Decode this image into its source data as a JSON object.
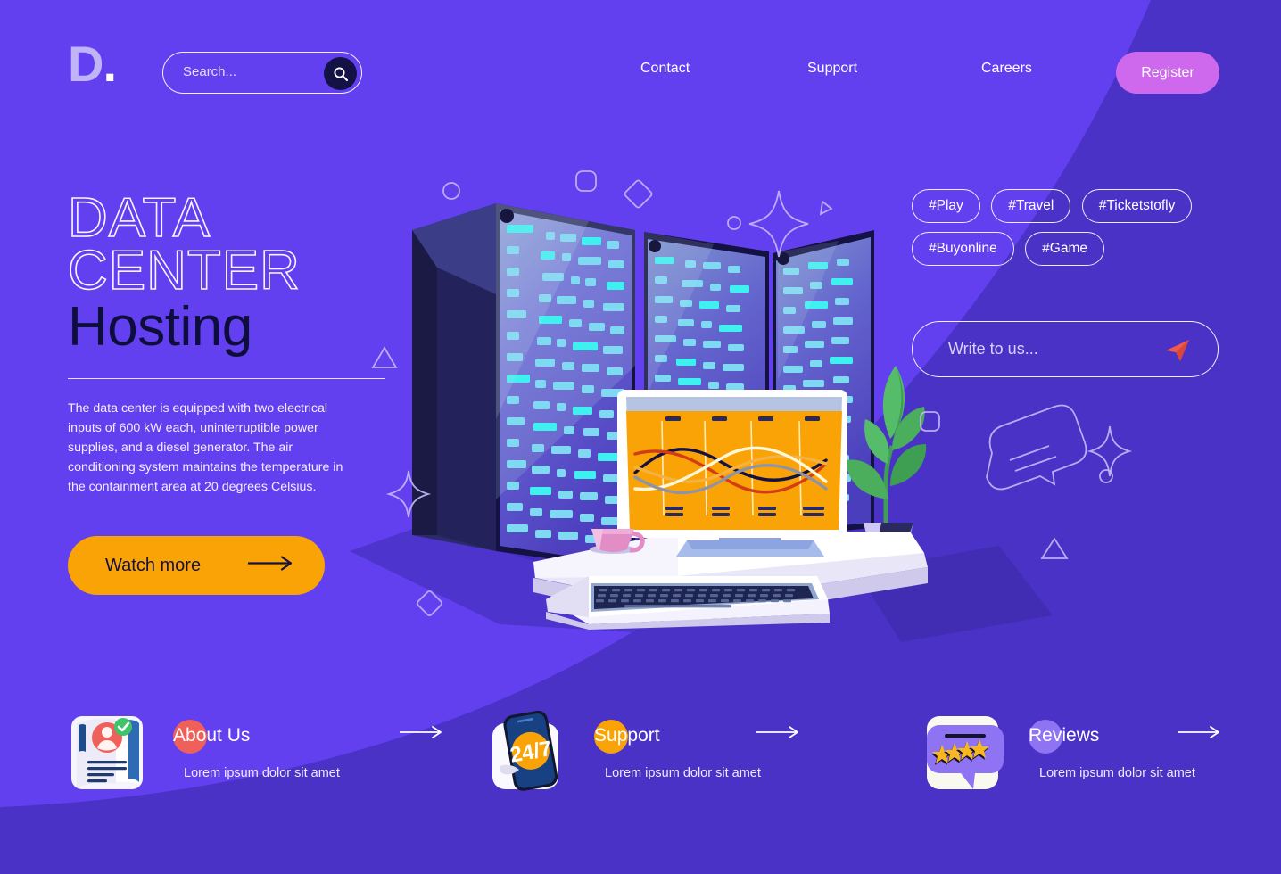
{
  "theme": {
    "bg_light": "#6240F0",
    "bg_dark": "#4A32C6",
    "accent_orange": "#F9A307",
    "accent_pink": "#CE69EE",
    "text_dark": "#0E0E3C",
    "coral": "#F0605B"
  },
  "header": {
    "logo": "D",
    "logo_dot": ".",
    "search": {
      "placeholder": "Search...",
      "icon": "search-icon"
    },
    "nav": [
      {
        "label": "Contact"
      },
      {
        "label": "Support"
      },
      {
        "label": "Careers"
      }
    ],
    "register_label": "Register"
  },
  "hero": {
    "title_line1": "DATA",
    "title_line2": "CENTER",
    "title_line3": "Hosting",
    "paragraph": "The data center is equipped with two electrical inputs of 600 kW each, uninterruptible power supplies, and a diesel generator. The air conditioning system maintains the temperature in the containment area at 20 degrees Celsius.",
    "cta_label": "Watch more"
  },
  "tags": [
    {
      "label": "#Play"
    },
    {
      "label": "#Travel"
    },
    {
      "label": "#Ticketstofly"
    },
    {
      "label": "#Buyonline"
    },
    {
      "label": "#Game"
    }
  ],
  "contact": {
    "placeholder": "Write to us...",
    "send_icon": "paper-plane-icon"
  },
  "features": [
    {
      "icon": "document-profile-icon",
      "initial": "A",
      "rest": "bout Us",
      "circle_color": "#F0605B",
      "subtitle": "Lorem ipsum dolor sit amet"
    },
    {
      "icon": "phone-24-7-icon",
      "initial": "S",
      "rest": "upport",
      "circle_color": "#F9A307",
      "subtitle": "Lorem ipsum dolor sit amet"
    },
    {
      "icon": "speech-bubble-stars-icon",
      "initial": "R",
      "rest": "eviews",
      "circle_color": "#8E74F2",
      "subtitle": "Lorem ipsum dolor sit amet"
    }
  ],
  "illustration": {
    "name": "data-center-workstation-illustration",
    "monitor_screen": "line-chart-amber-screen",
    "elements": [
      "server-rack-left",
      "server-rack-center",
      "server-rack-right",
      "desk",
      "keyboard",
      "monitor",
      "coffee-cup",
      "potted-plant"
    ]
  }
}
